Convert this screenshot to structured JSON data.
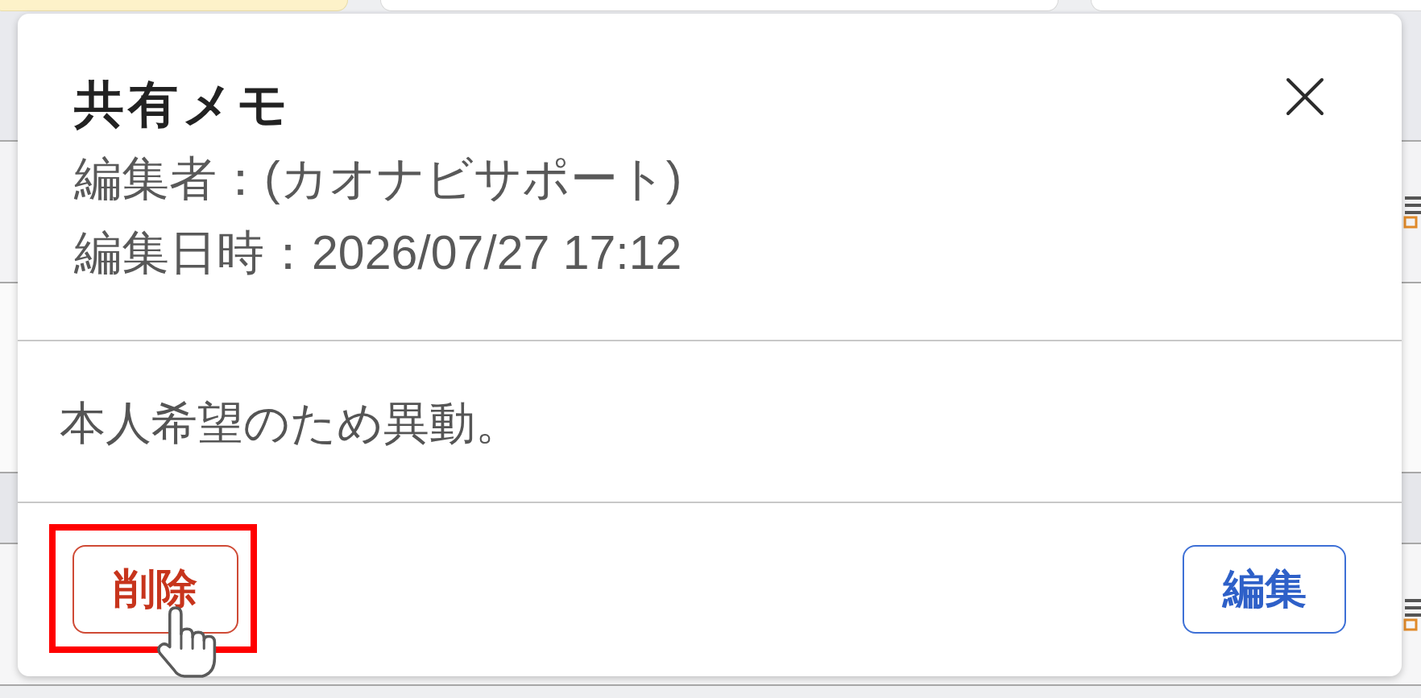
{
  "dialog": {
    "title": "共有メモ",
    "editor": "編集者：(カオナビサポート)",
    "edited_at": "編集日時：2026/07/27 17:12",
    "body": "本人希望のため異動。",
    "buttons": [
      {
        "label": "削除",
        "kind": "danger"
      },
      {
        "label": "編集",
        "kind": "primary"
      }
    ]
  }
}
